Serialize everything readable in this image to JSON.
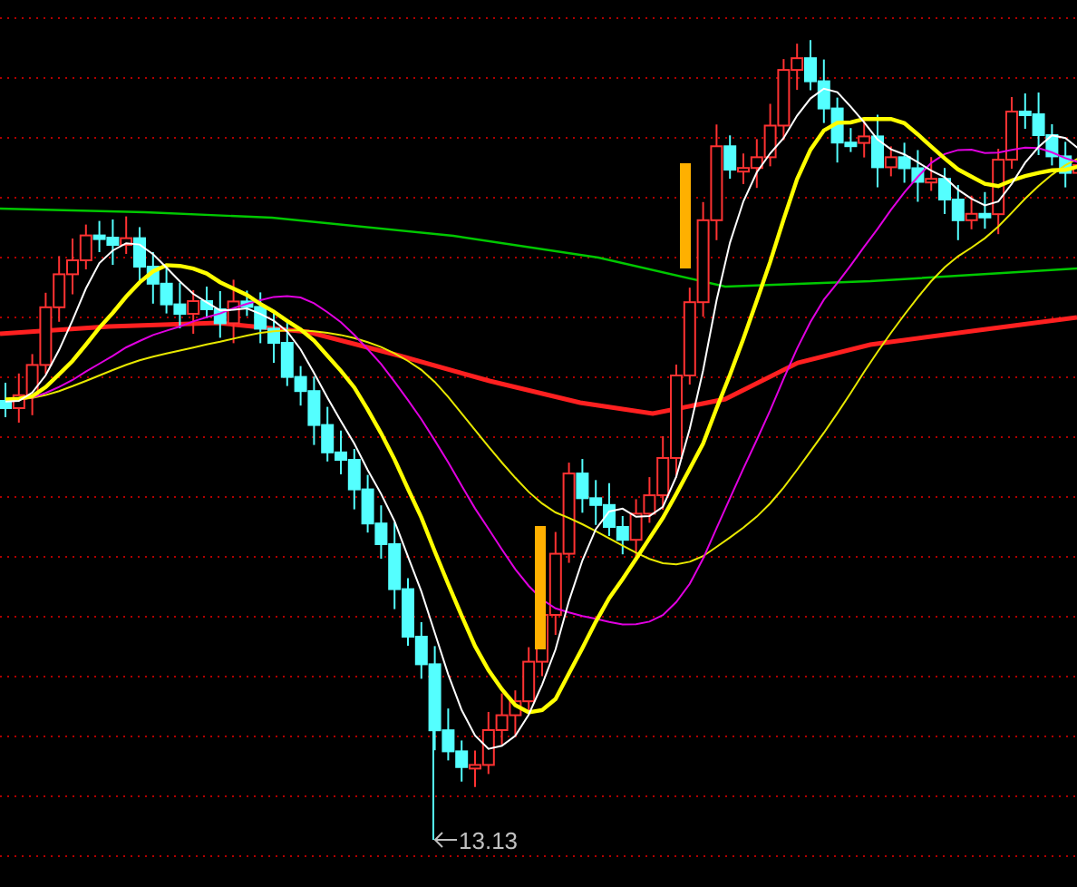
{
  "chart": {
    "low_price_label": "13.13"
  }
}
